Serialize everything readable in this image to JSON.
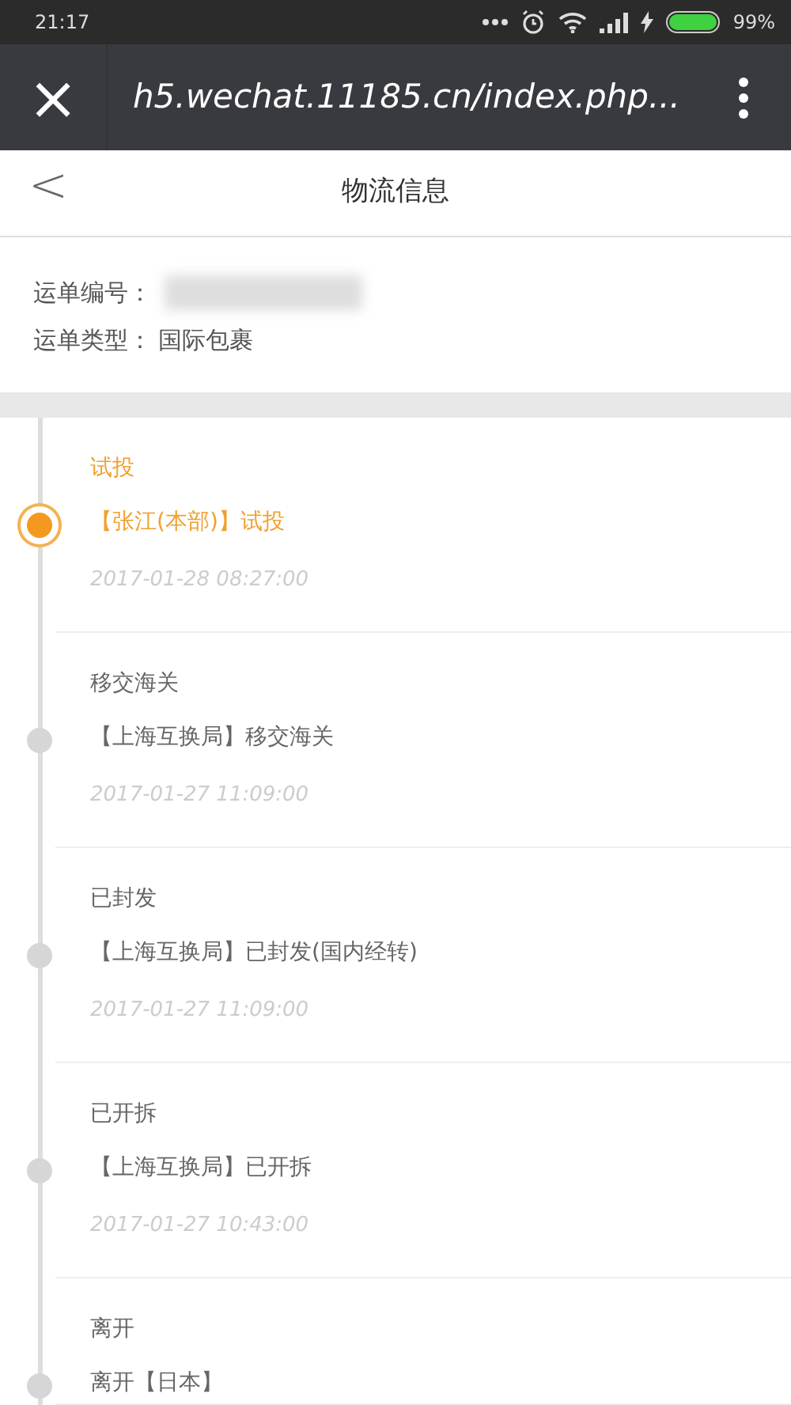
{
  "status_bar": {
    "time": "21:17",
    "battery_text": "99%"
  },
  "browser_bar": {
    "close": "×",
    "url": "h5.wechat.11185.cn/index.php..."
  },
  "header": {
    "back": "<",
    "title": "物流信息"
  },
  "waybill": {
    "number_label": "运单编号：",
    "number_redacted": true,
    "type_label": "运单类型：",
    "type_value": "国际包裹"
  },
  "events": [
    {
      "status": "试投",
      "detail": "【张江(本部)】试投",
      "time": "2017-01-28 08:27:00",
      "selected": true
    },
    {
      "status": "移交海关",
      "detail": "【上海互换局】移交海关",
      "time": "2017-01-27 11:09:00",
      "selected": false
    },
    {
      "status": "已封发",
      "detail": "【上海互换局】已封发(国内经转)",
      "time": "2017-01-27 11:09:00",
      "selected": false
    },
    {
      "status": "已开拆",
      "detail": "【上海互换局】已开拆",
      "time": "2017-01-27 10:43:00",
      "selected": false
    },
    {
      "status": "离开",
      "detail": "离开【日本】",
      "selected": false
    }
  ]
}
